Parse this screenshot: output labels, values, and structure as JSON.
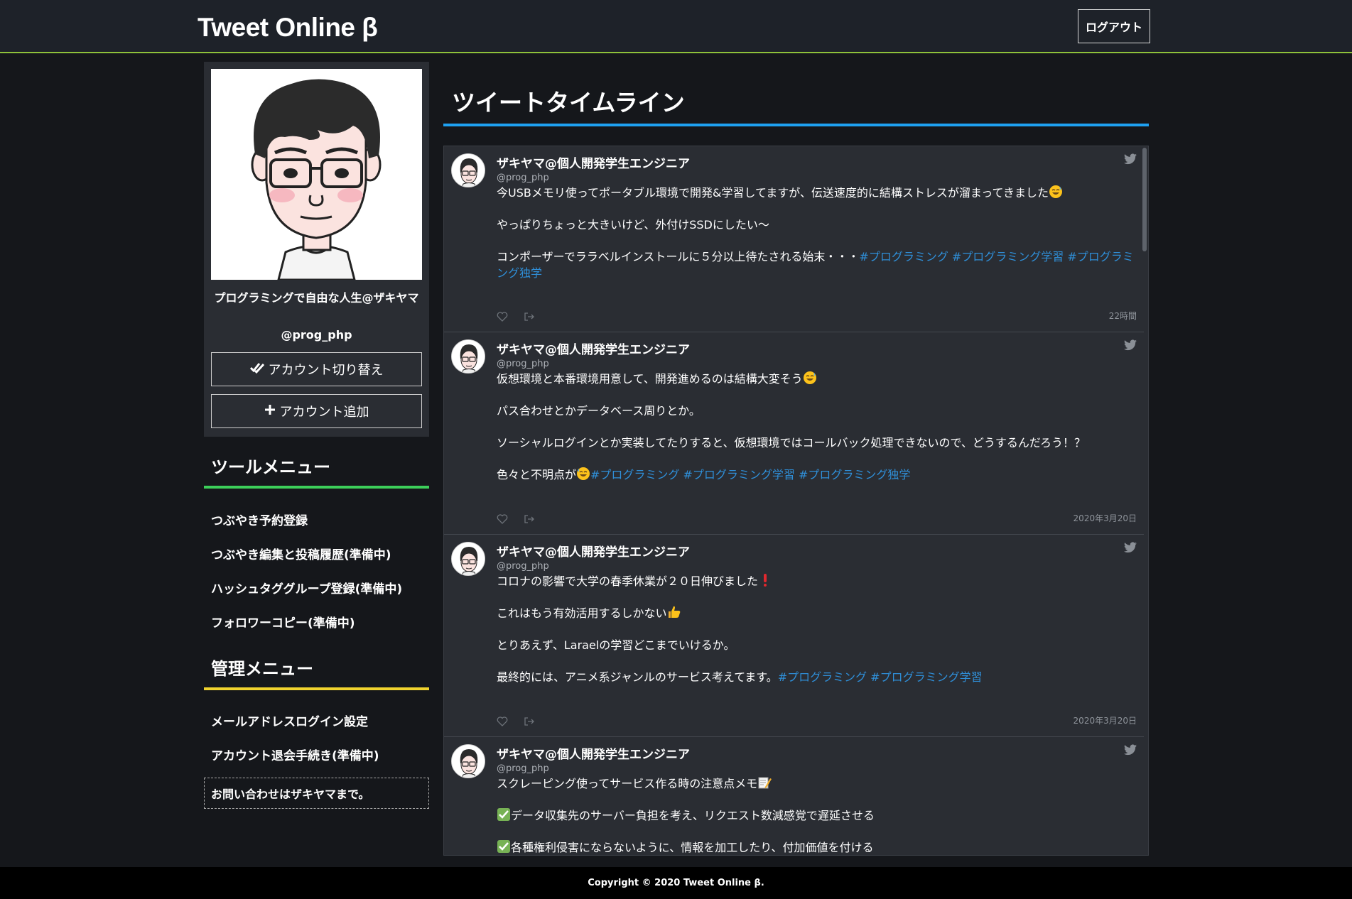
{
  "header": {
    "brand": "Tweet Online β",
    "logout_label": "ログアウト"
  },
  "profile": {
    "name": "プログラミングで自由な人生@ザキヤマ",
    "handle": "@prog_php",
    "switch_account_label": "アカウント切り替え",
    "add_account_label": "アカウント追加"
  },
  "tool_menu": {
    "title": "ツールメニュー",
    "items": [
      {
        "label": "つぶやき予約登録"
      },
      {
        "label": "つぶやき編集と投稿履歴(準備中)"
      },
      {
        "label": "ハッシュタググループ登録(準備中)"
      },
      {
        "label": "フォロワーコピー(準備中)"
      }
    ]
  },
  "admin_menu": {
    "title": "管理メニュー",
    "items": [
      {
        "label": "メールアドレスログイン設定"
      },
      {
        "label": "アカウント退会手続き(準備中)"
      }
    ]
  },
  "contact": "お問い合わせはザキヤマまで。",
  "main": {
    "title": "ツイートタイムライン"
  },
  "tweets": [
    {
      "name": "ザキヤマ@個人開発学生エンジニア",
      "handle": "@prog_php",
      "paragraphs": [
        "今USBメモリ使ってポータブル環境で開発&学習してますが、伝送速度的に結構ストレスが溜まってきました",
        "やっぱりちょっと大きいけど、外付けSSDにしたい〜",
        "コンポーザーでララベルインストールに５分以上待たされる始末・・・"
      ],
      "emoji": "sweat-smile-emoji",
      "tags": "#プログラミング #プログラミング学習 #プログラミング独学",
      "time": "22時間"
    },
    {
      "name": "ザキヤマ@個人開発学生エンジニア",
      "handle": "@prog_php",
      "paragraphs": [
        "仮想環境と本番環境用意して、開発進めるのは結構大変そう",
        "パス合わせとかデータベース周りとか。",
        "ソーシャルログインとか実装してたりすると、仮想環境ではコールバック処理できないので、どうするんだろう！？",
        "色々と不明点が"
      ],
      "tags": "#プログラミング #プログラミング学習 #プログラミング独学",
      "time": "2020年3月20日"
    },
    {
      "name": "ザキヤマ@個人開発学生エンジニア",
      "handle": "@prog_php",
      "paragraphs": [
        "コロナの影響で大学の春季休業が２０日伸びました",
        "これはもう有効活用するしかない",
        "とりあえず、Laraelの学習どこまでいけるか。",
        "最終的には、アニメ系ジャンルのサービス考えてます。"
      ],
      "tags": "#プログラミング #プログラミング学習",
      "time": "2020年3月20日"
    },
    {
      "name": "ザキヤマ@個人開発学生エンジニア",
      "handle": "@prog_php",
      "paragraphs": [
        "スクレーピング使ってサービス作る時の注意点メモ",
        "データ収集先のサーバー負担を考え、リクエスト数減感覚で遅延させる",
        "各種権利侵害にならないように、情報を加工したり、付加価値を付ける"
      ]
    }
  ],
  "footer": "Copyright © 2020 Tweet Online β."
}
